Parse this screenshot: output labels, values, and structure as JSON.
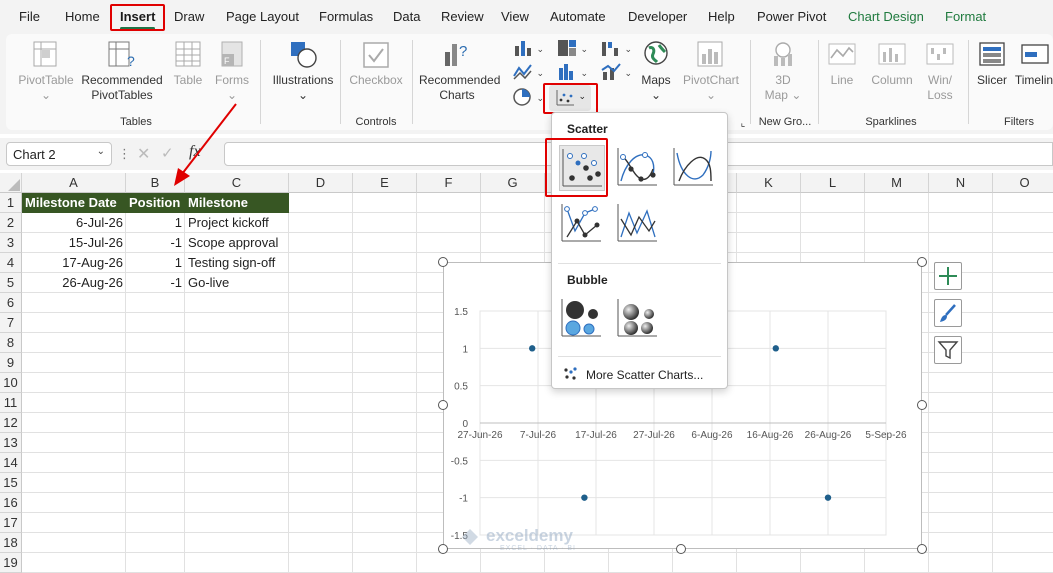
{
  "menu_tabs": [
    "File",
    "Home",
    "Insert",
    "Draw",
    "Page Layout",
    "Formulas",
    "Data",
    "Review",
    "View",
    "Automate",
    "Developer",
    "Help",
    "Power Pivot",
    "Chart Design",
    "Format"
  ],
  "ribbon": {
    "pivottable": "PivotTable",
    "recommended_pivottables": [
      "Recommended",
      "PivotTables"
    ],
    "table": "Table",
    "forms": "Forms",
    "tables_group": "Tables",
    "illustrations": "Illustrations",
    "checkbox": "Checkbox",
    "controls_group": "Controls",
    "recommended_charts": [
      "Recommended",
      "Charts"
    ],
    "maps": "Maps",
    "pivotchart": "PivotChart",
    "map3d": [
      "3D",
      "Map"
    ],
    "tours_group": "New Gro...",
    "line": "Line",
    "column": "Column",
    "winloss": [
      "Win/",
      "Loss"
    ],
    "sparklines_group": "Sparklines",
    "slicer": "Slicer",
    "timeline": "Timelin",
    "filters_group": "Filters"
  },
  "formula_bar": {
    "name_box": "Chart 2",
    "fx": "fx"
  },
  "columns": [
    "A",
    "B",
    "C",
    "D",
    "E",
    "F",
    "G",
    "H",
    "I",
    "J",
    "K",
    "L",
    "M",
    "N",
    "O"
  ],
  "rows": [
    "1",
    "2",
    "3",
    "4",
    "5",
    "6",
    "7",
    "8",
    "9",
    "10",
    "11",
    "12",
    "13",
    "14",
    "15",
    "16",
    "17",
    "18",
    "19"
  ],
  "table": {
    "headers": [
      "Milestone Date",
      "Position",
      "Milestone"
    ],
    "rows": [
      [
        "6-Jul-26",
        "1",
        "Project kickoff"
      ],
      [
        "15-Jul-26",
        "-1",
        "Scope approval"
      ],
      [
        "17-Aug-26",
        "1",
        "Testing sign-off"
      ],
      [
        "26-Aug-26",
        "-1",
        "Go-live"
      ]
    ]
  },
  "scatter_menu": {
    "scatter_title": "Scatter",
    "bubble_title": "Bubble",
    "more_link": "More Scatter Charts..."
  },
  "watermark": {
    "brand": "exceldemy",
    "tagline": "EXCEL · DATA · BI"
  },
  "colors": {
    "accent": "#217346",
    "header_fill": "#375623",
    "marker": "#1f5f8b",
    "highlight": "#e00000"
  },
  "chart_data": {
    "type": "scatter",
    "x_axis_type": "date",
    "x_tick_labels": [
      "27-Jun-26",
      "7-Jul-26",
      "17-Jul-26",
      "27-Jul-26",
      "6-Aug-26",
      "16-Aug-26",
      "26-Aug-26",
      "5-Sep-26"
    ],
    "y_tick_labels": [
      "1.5",
      "1",
      "0.5",
      "0",
      "-0.5",
      "-1",
      "-1.5"
    ],
    "xlim": [
      "2026-06-27",
      "2026-09-05"
    ],
    "ylim": [
      -1.5,
      1.5
    ],
    "grid": true,
    "points": [
      {
        "x": "2026-07-06",
        "y": 1
      },
      {
        "x": "2026-07-15",
        "y": -1
      },
      {
        "x": "2026-08-17",
        "y": 1
      },
      {
        "x": "2026-08-26",
        "y": -1
      }
    ]
  }
}
